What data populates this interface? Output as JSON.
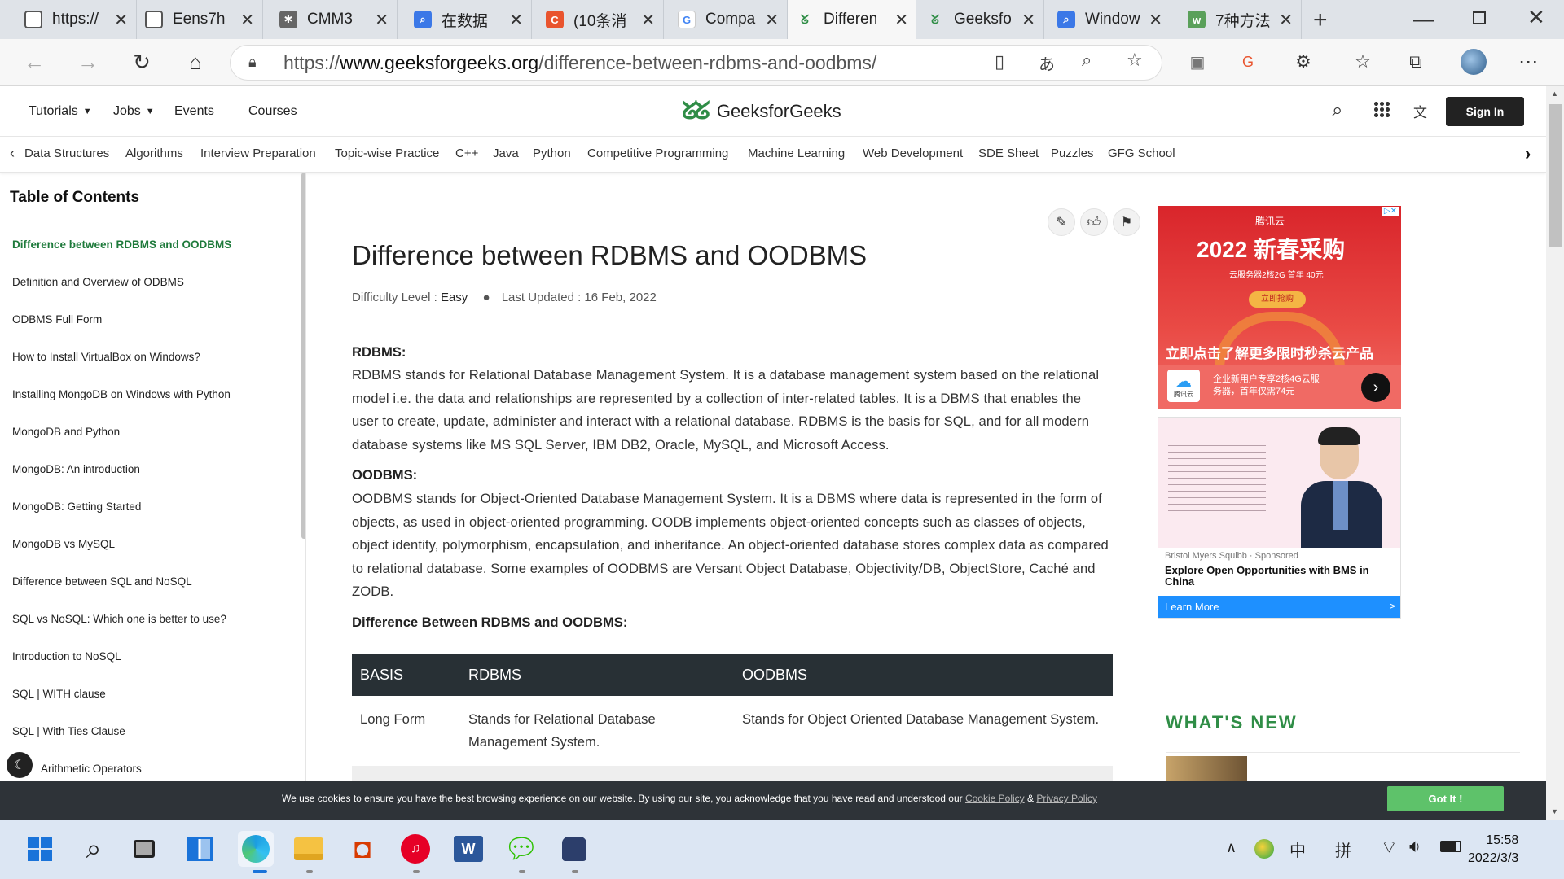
{
  "browser": {
    "tabs": [
      {
        "title": "https://",
        "color": "#555555"
      },
      {
        "title": "Eens7h",
        "color": "#555555"
      },
      {
        "title": "CMM3",
        "color": "#444444"
      },
      {
        "title": "在数据",
        "color": "#3b78e7"
      },
      {
        "title": "(10条消",
        "color": "#e9542e"
      },
      {
        "title": "Compa",
        "color": "#4285f4"
      },
      {
        "title": "Differen",
        "color": "#2f8d46"
      },
      {
        "title": "Geeksfo",
        "color": "#2f8d46"
      },
      {
        "title": "Window",
        "color": "#3b78e7"
      },
      {
        "title": "7种方法",
        "color": "#5aa05a"
      }
    ],
    "url": {
      "prefix": "https://",
      "domain": "www.geeksforgeeks.org",
      "path": "/difference-between-rdbms-and-oodbms/"
    }
  },
  "site": {
    "nav": [
      "Tutorials",
      "Jobs",
      "Events",
      "Courses"
    ],
    "logo_text": "GeeksforGeeks",
    "sign_in": "Sign In",
    "categories": [
      "Data Structures",
      "Algorithms",
      "Interview Preparation",
      "Topic-wise Practice",
      "C++",
      "Java",
      "Python",
      "Competitive Programming",
      "Machine Learning",
      "Web Development",
      "SDE Sheet",
      "Puzzles",
      "GFG School"
    ]
  },
  "toc": {
    "heading": "Table of Contents",
    "items": [
      "Difference between RDBMS and OODBMS",
      "Definition and Overview of ODBMS",
      "ODBMS Full Form",
      "How to Install VirtualBox on Windows?",
      "Installing MongoDB on Windows with Python",
      "MongoDB and Python",
      "MongoDB: An introduction",
      "MongoDB: Getting Started",
      "MongoDB vs MySQL",
      "Difference between SQL and NoSQL",
      "SQL vs NoSQL: Which one is better to use?",
      "Introduction to NoSQL",
      "SQL | WITH clause",
      "SQL | With Ties Clause",
      "Arithmetic Operators"
    ]
  },
  "article": {
    "title": "Difference between RDBMS and OODBMS",
    "difficulty_label": "Difficulty Level : ",
    "difficulty": "Easy",
    "updated": "Last Updated : 16 Feb, 2022",
    "rdbms_heading": "RDBMS:",
    "rdbms_text": "RDBMS stands for Relational Database Management System. It is a database management system based on the relational model i.e. the data and relationships are represented by a collection of inter-related tables. It is a DBMS that enables the user to create, update, administer and interact with a relational database. RDBMS is the basis for SQL, and for all modern database systems like MS SQL Server, IBM DB2, Oracle, MySQL, and Microsoft Access.",
    "oodbms_heading": "OODBMS:",
    "oodbms_text": "OODBMS stands for Object-Oriented Database Management System. It is a DBMS where data is represented in the form of objects, as used in object-oriented programming. OODB implements object-oriented concepts such as classes of objects, object identity, polymorphism, encapsulation, and inheritance. An object-oriented database stores complex data as compared to relational database. Some examples of OODBMS are Versant Object Database, Objectivity/DB, ObjectStore, Caché and ZODB.",
    "diff_heading": "Difference Between RDBMS and OODBMS:",
    "table": {
      "headers": [
        "BASIS",
        "RDBMS",
        "OODBMS"
      ],
      "rows": [
        [
          "Long Form",
          "Stands for Relational Database Management System.",
          "Stands for Object Oriented Database Management System."
        ]
      ]
    }
  },
  "ads": {
    "ad1_title": "2022 新春采购",
    "ad1_sub": "云服务器2核2G 首年 40元",
    "ad1_btn": "立即抢购",
    "ad1_banner": "立即点击了解更多限时秒杀云产品",
    "ad1_brand_text": "企业新用户专享2核4G云服务器，首年仅需74元",
    "ad1_brand_name": "腾讯云",
    "ad1_logo": "腾讯云",
    "ad2_sponsor": "Bristol Myers Squibb · Sponsored",
    "ad2_title": "Explore Open Opportunities with BMS in China",
    "ad2_cta": "Learn More",
    "ad2_arrow": ">"
  },
  "whats_new": "WHAT'S NEW",
  "cookie": {
    "text": "We use cookies to ensure you have the best browsing experience on our website. By using our site, you acknowledge that you have read and understood our ",
    "cookie_policy": "Cookie Policy",
    "amp": " & ",
    "privacy_policy": "Privacy Policy",
    "button": "Got It !"
  },
  "taskbar": {
    "ime_zh": "中",
    "ime_pin": "拼",
    "time": "15:58",
    "date": "2022/3/3"
  }
}
